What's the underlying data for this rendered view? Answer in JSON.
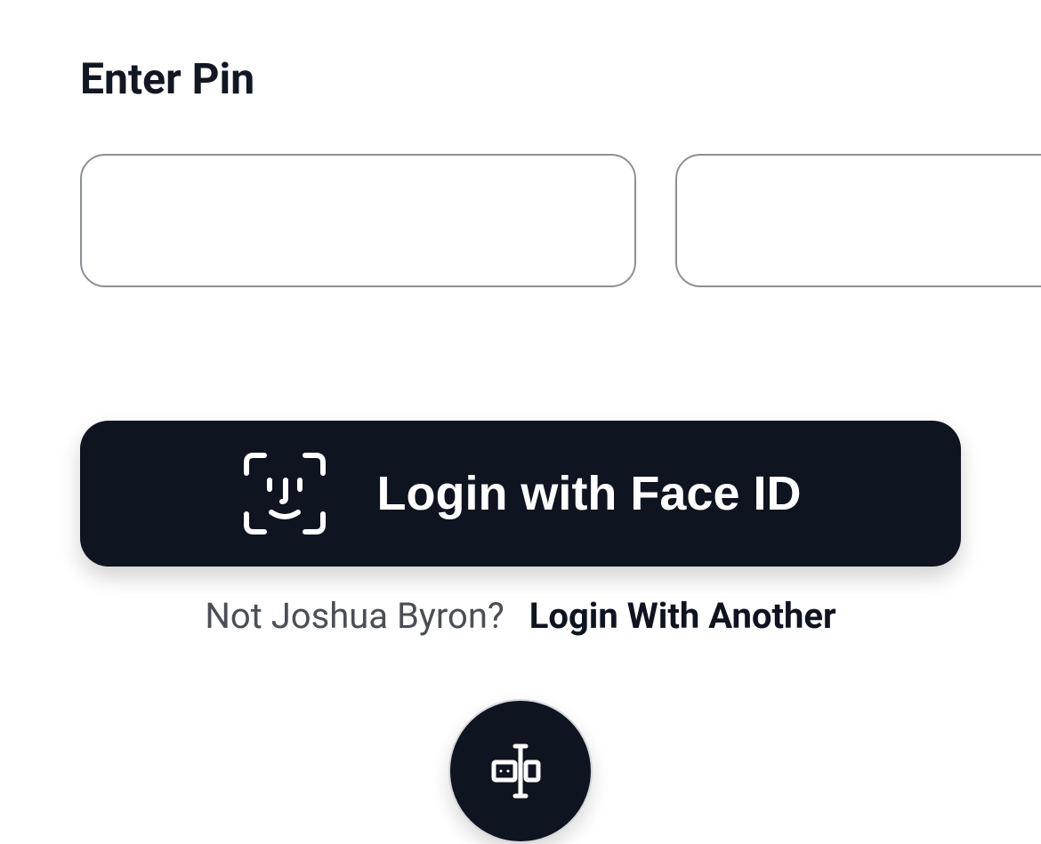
{
  "header": {
    "title": "Enter Pin"
  },
  "pin": {
    "values": [
      "",
      "",
      "",
      ""
    ]
  },
  "actions": {
    "faceid_label": "Login with Face ID",
    "not_user_prefix": "Not Joshua Byron?",
    "switch_user_label": "Login With Another"
  },
  "colors": {
    "dark": "#0e1420",
    "border": "#8c8f93",
    "text_muted": "#4a4f57"
  }
}
